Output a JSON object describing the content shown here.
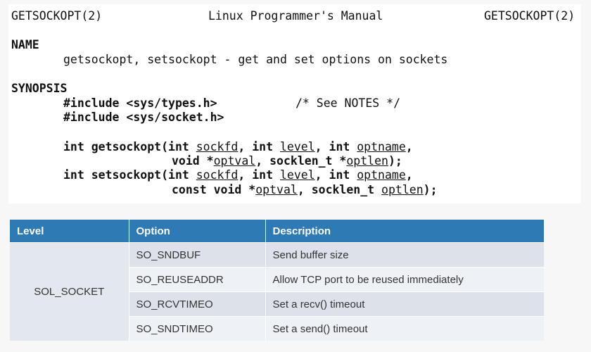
{
  "header": {
    "left": "GETSOCKOPT(2)",
    "center": "Linux Programmer's Manual",
    "right": "GETSOCKOPT(2)"
  },
  "name_section": {
    "heading": "NAME",
    "text": "getsockopt, setsockopt - get and set options on sockets"
  },
  "synopsis": {
    "heading": "SYNOPSIS",
    "include1": "#include <sys/types.h>",
    "include1_comment": "/* See NOTES */",
    "include2": "#include <sys/socket.h>",
    "get": {
      "prefix": "int getsockopt(int ",
      "arg1": "sockfd",
      "sep1": ", int ",
      "arg2": "level",
      "sep2": ", int ",
      "arg3": "optname",
      "sep3": ",",
      "cont_prefix": "void *",
      "arg4": "optval",
      "sep4": ", socklen_t *",
      "arg5": "optlen",
      "end": ");"
    },
    "set": {
      "prefix": "int setsockopt(int ",
      "arg1": "sockfd",
      "sep1": ", int ",
      "arg2": "level",
      "sep2": ", int ",
      "arg3": "optname",
      "sep3": ",",
      "cont_prefix": "const void *",
      "arg4": "optval",
      "sep4": ", socklen_t ",
      "arg5": "optlen",
      "end": ");"
    }
  },
  "table": {
    "headers": [
      "Level",
      "Option",
      "Description"
    ],
    "level": "SOL_SOCKET",
    "rows": [
      {
        "option": "SO_SNDBUF",
        "description": "Send buffer size"
      },
      {
        "option": "SO_REUSEADDR",
        "description": "Allow TCP port to be reused immediately"
      },
      {
        "option": "SO_RCVTIMEO",
        "description": "Set a recv() timeout"
      },
      {
        "option": "SO_SNDTIMEO",
        "description": "Set a send() timeout"
      }
    ],
    "header_color": "#2d7ab5"
  }
}
